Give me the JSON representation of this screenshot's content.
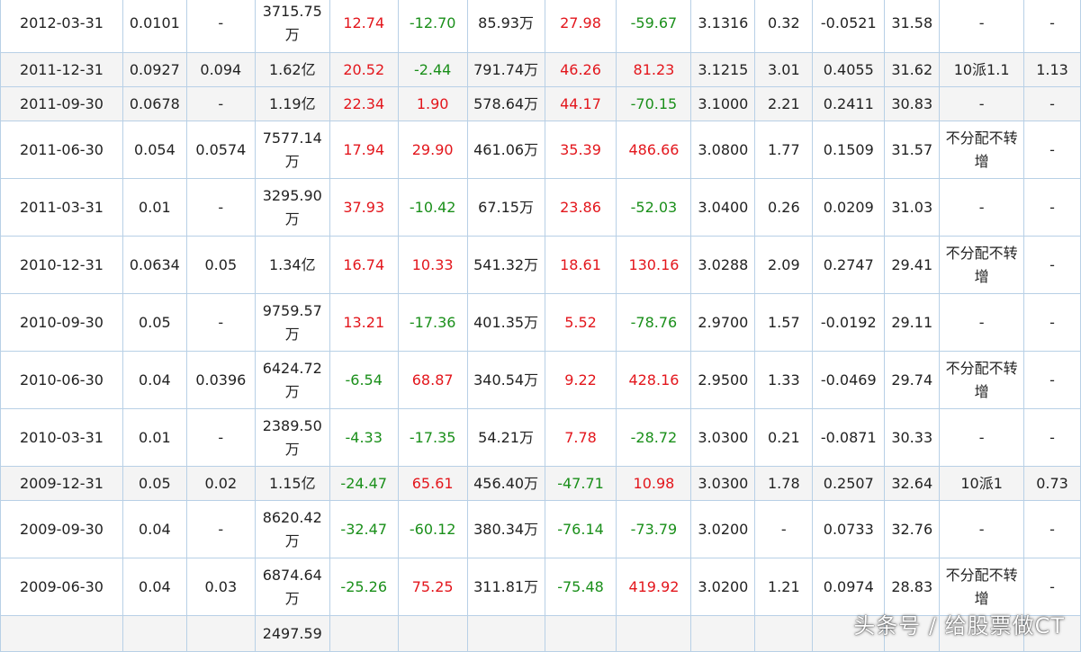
{
  "rows": [
    [
      "2012-03-31",
      "0.0101",
      "-",
      "3715.75万",
      "12.74",
      "-12.70",
      "85.93万",
      "27.98",
      "-59.67",
      "3.1316",
      "0.32",
      "-0.0521",
      "31.58",
      "-",
      "-"
    ],
    [
      "2011-12-31",
      "0.0927",
      "0.094",
      "1.62亿",
      "20.52",
      "-2.44",
      "791.74万",
      "46.26",
      "81.23",
      "3.1215",
      "3.01",
      "0.4055",
      "31.62",
      "10派1.1",
      "1.13"
    ],
    [
      "2011-09-30",
      "0.0678",
      "-",
      "1.19亿",
      "22.34",
      "1.90",
      "578.64万",
      "44.17",
      "-70.15",
      "3.1000",
      "2.21",
      "0.2411",
      "30.83",
      "-",
      "-"
    ],
    [
      "2011-06-30",
      "0.054",
      "0.0574",
      "7577.14万",
      "17.94",
      "29.90",
      "461.06万",
      "35.39",
      "486.66",
      "3.0800",
      "1.77",
      "0.1509",
      "31.57",
      "不分配不转增",
      "-"
    ],
    [
      "2011-03-31",
      "0.01",
      "-",
      "3295.90万",
      "37.93",
      "-10.42",
      "67.15万",
      "23.86",
      "-52.03",
      "3.0400",
      "0.26",
      "0.0209",
      "31.03",
      "-",
      "-"
    ],
    [
      "2010-12-31",
      "0.0634",
      "0.05",
      "1.34亿",
      "16.74",
      "10.33",
      "541.32万",
      "18.61",
      "130.16",
      "3.0288",
      "2.09",
      "0.2747",
      "29.41",
      "不分配不转增",
      "-"
    ],
    [
      "2010-09-30",
      "0.05",
      "-",
      "9759.57万",
      "13.21",
      "-17.36",
      "401.35万",
      "5.52",
      "-78.76",
      "2.9700",
      "1.57",
      "-0.0192",
      "29.11",
      "-",
      "-"
    ],
    [
      "2010-06-30",
      "0.04",
      "0.0396",
      "6424.72万",
      "-6.54",
      "68.87",
      "340.54万",
      "9.22",
      "428.16",
      "2.9500",
      "1.33",
      "-0.0469",
      "29.74",
      "不分配不转增",
      "-"
    ],
    [
      "2010-03-31",
      "0.01",
      "-",
      "2389.50万",
      "-4.33",
      "-17.35",
      "54.21万",
      "7.78",
      "-28.72",
      "3.0300",
      "0.21",
      "-0.0871",
      "30.33",
      "-",
      "-"
    ],
    [
      "2009-12-31",
      "0.05",
      "0.02",
      "1.15亿",
      "-24.47",
      "65.61",
      "456.40万",
      "-47.71",
      "10.98",
      "3.0300",
      "1.78",
      "0.2507",
      "32.64",
      "10派1",
      "0.73"
    ],
    [
      "2009-09-30",
      "0.04",
      "-",
      "8620.42万",
      "-32.47",
      "-60.12",
      "380.34万",
      "-76.14",
      "-73.79",
      "3.0200",
      "-",
      "0.0733",
      "32.76",
      "-",
      "-"
    ],
    [
      "2009-06-30",
      "0.04",
      "0.03",
      "6874.64万",
      "-25.26",
      "75.25",
      "311.81万",
      "-75.48",
      "419.92",
      "3.0200",
      "1.21",
      "0.0974",
      "28.83",
      "不分配不转增",
      "-"
    ],
    [
      "",
      "",
      "",
      "2497.59",
      "",
      "",
      "",
      "",
      "",
      "",
      "",
      "",
      "",
      "",
      ""
    ]
  ],
  "colors": {
    "up": "#e3161c",
    "down": "#1a8f1a",
    "border": "#b8d0e6"
  },
  "watermark": "头条号 / 给股票做CT"
}
